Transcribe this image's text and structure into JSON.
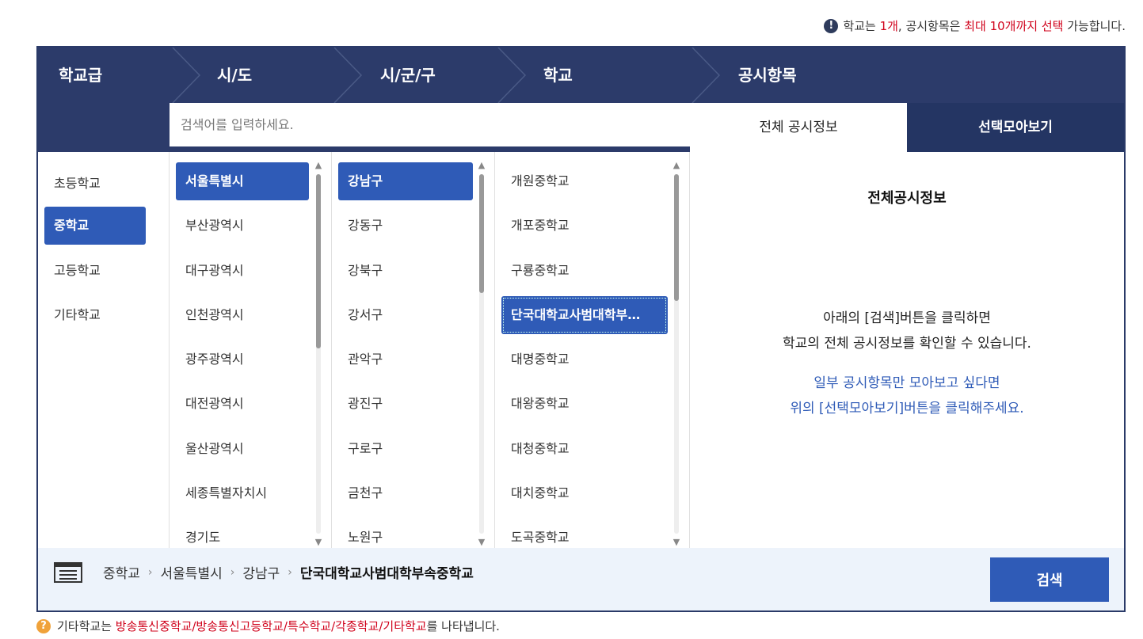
{
  "notice_top": {
    "p1": "학교는 ",
    "p2": "1개",
    "p3": ", 공시항목은 ",
    "p4": "최대 10개까지 선택",
    "p5": " 가능합니다."
  },
  "steps": [
    "학교급",
    "시/도",
    "시/군/구",
    "학교",
    "공시항목"
  ],
  "search": {
    "placeholder": "검색어를 입력하세요."
  },
  "tabs": {
    "all": "전체 공시정보",
    "collect": "선택모아보기"
  },
  "levels": [
    "초등학교",
    "중학교",
    "고등학교",
    "기타학교"
  ],
  "provinces": [
    "서울특별시",
    "부산광역시",
    "대구광역시",
    "인천광역시",
    "광주광역시",
    "대전광역시",
    "울산광역시",
    "세종특별자치시",
    "경기도"
  ],
  "districts": [
    "강남구",
    "강동구",
    "강북구",
    "강서구",
    "관악구",
    "광진구",
    "구로구",
    "금천구",
    "노원구"
  ],
  "schools": [
    "개원중학교",
    "개포중학교",
    "구룡중학교",
    "단국대학교사범대학부…",
    "대명중학교",
    "대왕중학교",
    "대청중학교",
    "대치중학교",
    "도곡중학교"
  ],
  "info": {
    "title": "전체공시정보",
    "line1": "아래의 [검색]버튼을 클릭하면",
    "line2": "학교의 전체 공시정보를 확인할 수 있습니다.",
    "line3": "일부 공시항목만 모아보고 싶다면",
    "line4": "위의 [선택모아보기]버튼을 클릭해주세요."
  },
  "breadcrumb": [
    "중학교",
    "서울특별시",
    "강남구",
    "단국대학교사범대학부속중학교"
  ],
  "search_button": "검색",
  "notice_bottom": {
    "p1": "기타학교는 ",
    "p2": "방송통신중학교/방송통신고등학교/특수학교/각종학교/기타학교",
    "p3": "를 나타냅니다."
  },
  "colors": {
    "navy": "#2c3b6a",
    "accent": "#2f5bb7",
    "red": "#d0021b"
  }
}
